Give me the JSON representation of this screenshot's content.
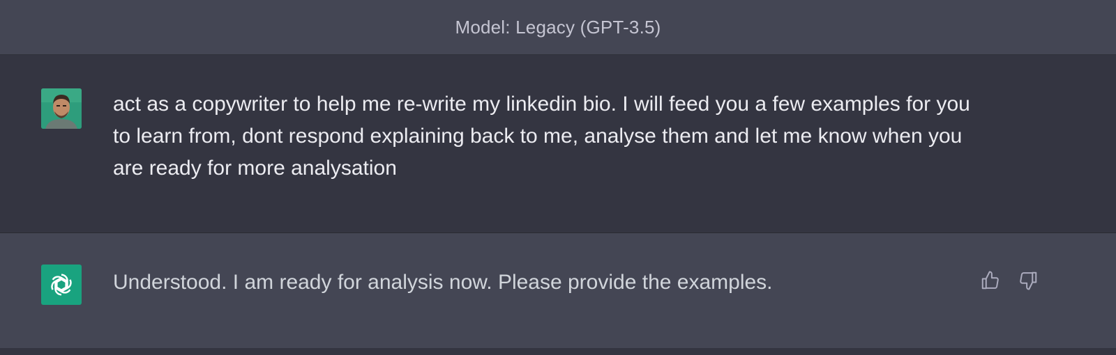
{
  "header": {
    "title": "Model: Legacy (GPT-3.5)"
  },
  "conversation": {
    "user_message": {
      "avatar": "user-photo-avatar",
      "text": "act as a copywriter to help me re-write my linkedin bio. I will feed you a few examples for you to learn from, dont respond explaining back to me, analyse them and let me know when you are ready for more analysation"
    },
    "assistant_message": {
      "avatar": "openai-logo-icon",
      "text": "Understood. I am ready for analysis now. Please provide the examples.",
      "feedback": {
        "thumbs_up_icon": "thumbs-up-icon",
        "thumbs_down_icon": "thumbs-down-icon"
      }
    }
  },
  "colors": {
    "accent": "#19a37f",
    "user_bg": "#343541",
    "assistant_bg": "#444654"
  }
}
